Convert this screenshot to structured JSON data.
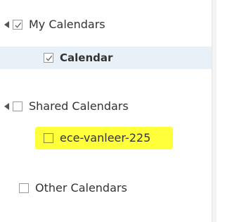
{
  "my_calendars": {
    "label": "My Calendars",
    "checked": true,
    "expanded": true,
    "items": [
      {
        "label": "Calendar",
        "checked": true,
        "selected": true
      }
    ]
  },
  "shared_calendars": {
    "label": "Shared Calendars",
    "checked": false,
    "expanded": true,
    "items": [
      {
        "label": "ece-vanleer-225",
        "checked": false,
        "highlighted": true
      }
    ]
  },
  "other_calendars": {
    "label": "Other Calendars",
    "checked": false
  },
  "colors": {
    "selection": "#e8f1f8",
    "highlight": "#ffff3a",
    "text": "#333333"
  }
}
